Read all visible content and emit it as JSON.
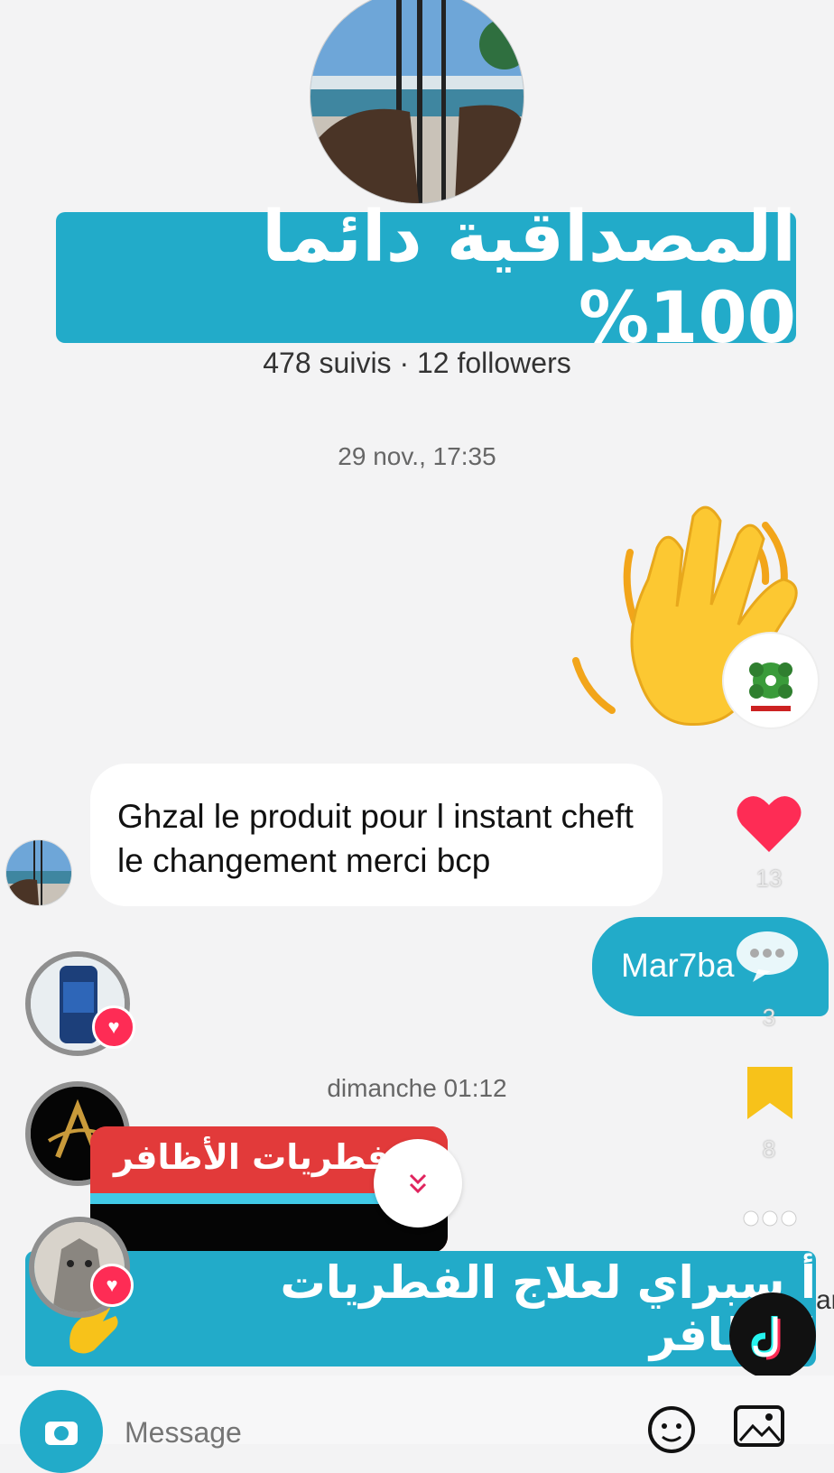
{
  "profile": {
    "banner_text": "المصداقية دائما 100%",
    "stats": "478 suivis · 12 followers"
  },
  "conversation": {
    "time_1": "29 nov., 17:35",
    "received_message": "Ghzal le produit pour l instant cheft le changement merci bcp",
    "sent_message": "Mar7ba",
    "time_2": "dimanche 01:12",
    "shared_card_text": "ج فطريات الأظافر"
  },
  "live_overlay": {
    "bottom_banner_text": "أ سبراي لعلاج الفطريات الأظافر",
    "edge_text": "ar"
  },
  "rail": {
    "like_count": "13",
    "comment_count": "3",
    "save_count": "8"
  },
  "input": {
    "placeholder": "Message"
  },
  "colors": {
    "accent": "#22abc9",
    "heart": "#fe2c55",
    "save": "#f7c21a"
  },
  "icons": [
    "wave-emoji",
    "heart-icon",
    "comment-icon",
    "bookmark-icon",
    "more-icon",
    "camera-icon",
    "sticker-icon",
    "image-icon",
    "chevron-down-icon",
    "tiktok-logo"
  ]
}
